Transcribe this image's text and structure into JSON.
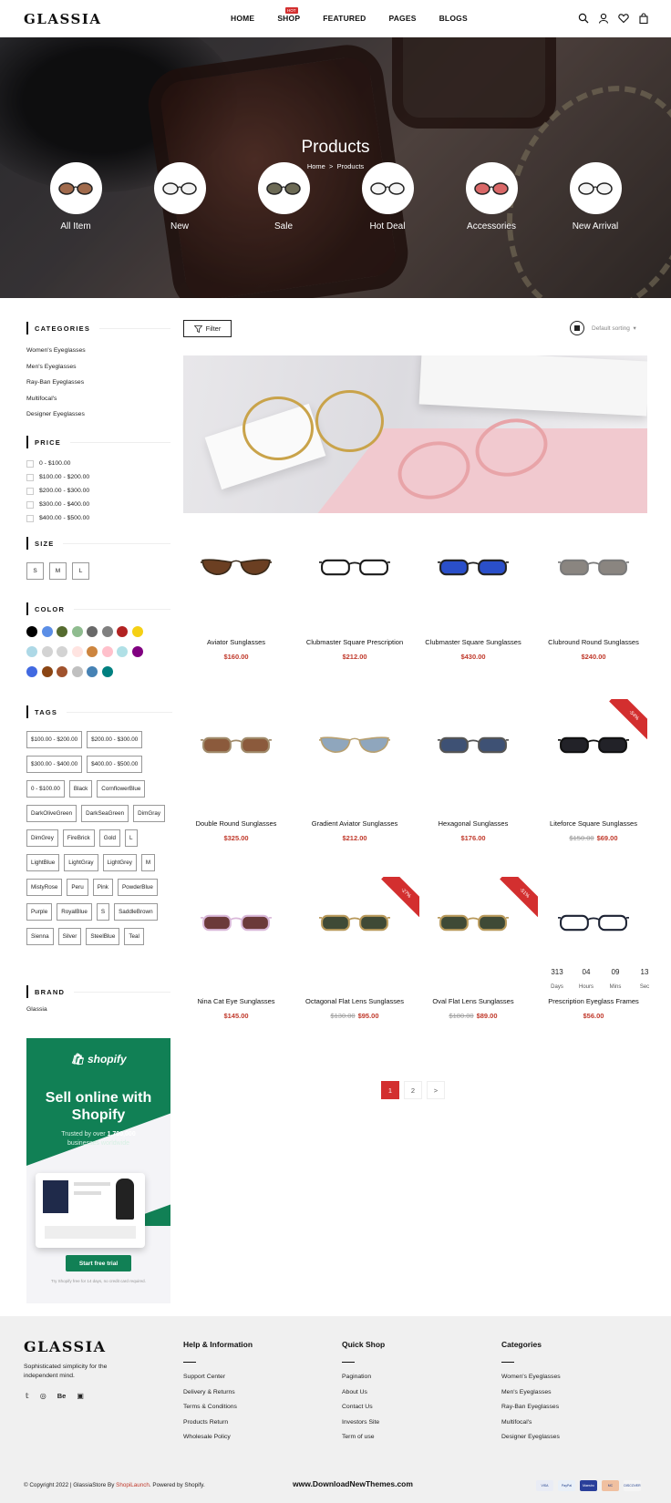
{
  "header": {
    "logo": "GLASSIA",
    "nav": [
      "HOME",
      "SHOP",
      "FEATURED",
      "PAGES",
      "BLOGS"
    ],
    "hot_badge": "HOT"
  },
  "hero": {
    "title": "Products",
    "breadcrumb_home": "Home",
    "breadcrumb_sep": ">",
    "breadcrumb_current": "Products",
    "categories": [
      "All Item",
      "New",
      "Sale",
      "Hot Deal",
      "Accessories",
      "New Arrival"
    ]
  },
  "sidebar": {
    "categories_title": "CATEGORIES",
    "categories": [
      "Women's Eyeglasses",
      "Men's Eyeglasses",
      "Ray-Ban Eyeglasses",
      "Multifocal's",
      "Designer Eyeglasses"
    ],
    "price_title": "PRICE",
    "prices": [
      "0 - $100.00",
      "$100.00 - $200.00",
      "$200.00 - $300.00",
      "$300.00 - $400.00",
      "$400.00 - $500.00"
    ],
    "size_title": "SIZE",
    "sizes": [
      "S",
      "M",
      "L"
    ],
    "color_title": "COLOR",
    "colors": [
      "#000000",
      "#5b8ee6",
      "#556b2f",
      "#8fbc8f",
      "#696969",
      "#808080",
      "#b22222",
      "#f5d015",
      "#add8e6",
      "#d3d3d3",
      "#d3d3d3",
      "#ffe4e1",
      "#cd853f",
      "#ffc0cb",
      "#b0e0e6",
      "#800080",
      "#4169e1",
      "#8b4513",
      "#a0522d",
      "#c0c0c0",
      "#4682b4",
      "#008080"
    ],
    "tags_title": "TAGS",
    "tags": [
      "$100.00 - $200.00",
      "$200.00 - $300.00",
      "$300.00 - $400.00",
      "$400.00 - $500.00",
      "0 - $100.00",
      "Black",
      "CornflowerBlue",
      "DarkOliveGreen",
      "DarkSeaGreen",
      "DimGray",
      "DimGrey",
      "FireBrick",
      "Gold",
      "L",
      "LightBlue",
      "LightGray",
      "LightGrey",
      "M",
      "MistyRose",
      "Peru",
      "Pink",
      "PowderBlue",
      "Purple",
      "RoyalBlue",
      "S",
      "SaddleBrown",
      "Sienna",
      "Silver",
      "SteelBlue",
      "Teal"
    ],
    "brand_title": "BRAND",
    "brand": "Glassia"
  },
  "toolbar": {
    "filter": "Filter",
    "sort": "Default sorting"
  },
  "products": [
    {
      "name": "Aviator Sunglasses",
      "price": "$160.00",
      "old": "",
      "badge": "",
      "lens": "#6b3f22",
      "frame": "#3a2a1a"
    },
    {
      "name": "Clubmaster Square Prescription",
      "price": "$212.00",
      "old": "",
      "badge": "",
      "lens": "#ffffff",
      "frame": "#1a1a1a"
    },
    {
      "name": "Clubmaster Square Sunglasses",
      "price": "$430.00",
      "old": "",
      "badge": "",
      "lens": "#2a4fc9",
      "frame": "#222222"
    },
    {
      "name": "Clubround Round Sunglasses",
      "price": "$240.00",
      "old": "",
      "badge": "",
      "lens": "#8a8580",
      "frame": "#7a7a7a"
    },
    {
      "name": "Double Round Sunglasses",
      "price": "$325.00",
      "old": "",
      "badge": "",
      "lens": "#8b5a3c",
      "frame": "#a08a6a"
    },
    {
      "name": "Gradient Aviator Sunglasses",
      "price": "$212.00",
      "old": "",
      "badge": "",
      "lens": "#8fa6bd",
      "frame": "#b8a070"
    },
    {
      "name": "Hexagonal Sunglasses",
      "price": "$176.00",
      "old": "",
      "badge": "",
      "lens": "#3e5174",
      "frame": "#555555"
    },
    {
      "name": "Liteforce Square Sunglasses",
      "price": "$69.00",
      "old": "$150.00",
      "badge": "-54%",
      "lens": "#222228",
      "frame": "#111111"
    },
    {
      "name": "Nina Cat Eye Sunglasses",
      "price": "$145.00",
      "old": "",
      "badge": "",
      "lens": "#6b3a3a",
      "frame": "#d9b8d9"
    },
    {
      "name": "Octagonal Flat Lens Sunglasses",
      "price": "$95.00",
      "old": "$130.00",
      "badge": "-27%",
      "lens": "#3f4a36",
      "frame": "#b8995a"
    },
    {
      "name": "Oval Flat Lens Sunglasses",
      "price": "$89.00",
      "old": "$180.00",
      "badge": "-51%",
      "lens": "#3f4a36",
      "frame": "#b8995a"
    },
    {
      "name": "Prescription Eyeglass Frames",
      "price": "$56.00",
      "old": "",
      "badge": "",
      "lens": "#ffffff",
      "frame": "#1c2233"
    }
  ],
  "countdown": [
    {
      "v": "313",
      "l": "Days"
    },
    {
      "v": "04",
      "l": "Hours"
    },
    {
      "v": "09",
      "l": "Mins"
    },
    {
      "v": "13",
      "l": "Sec"
    }
  ],
  "pagination": [
    "1",
    "2",
    ">"
  ],
  "shopify": {
    "brand": "shopify",
    "headline": "Sell online with Shopify",
    "sub": "Trusted by over",
    "sub_bold": "1,700,000",
    "sub2": "businesses worldwide",
    "cta": "Start free trial",
    "note": "Try Shopify free for 14 days, no credit card required."
  },
  "footer": {
    "logo": "GLASSIA",
    "tagline": "Sophisticated simplicity for the independent mind.",
    "social": [
      "twitter-icon",
      "dribbble-icon",
      "behance-icon",
      "instagram-icon"
    ],
    "cols": [
      {
        "title": "Help & Information",
        "links": [
          "Support Center",
          "Delivery & Returns",
          "Terms & Conditions",
          "Products Return",
          "Wholesale Policy"
        ]
      },
      {
        "title": "Quick Shop",
        "links": [
          "Pagination",
          "About Us",
          "Contact Us",
          "Investors Site",
          "Term of use"
        ]
      },
      {
        "title": "Categories",
        "links": [
          "Women's Eyeglasses",
          "Men's Eyeglasses",
          "Ray-Ban Eyeglasses",
          "Multifocal's",
          "Designer Eyeglasses"
        ]
      }
    ],
    "copyright_a": "© Copyright 2022 | GlassiaStore By",
    "copyright_brand": "ShopiLaunch",
    "copyright_b": ". Powered by Shopify.",
    "watermark": "www.DownloadNewThemes.com",
    "payments": [
      "VISA",
      "PayPal",
      "Maestro",
      "MC",
      "DISCOVER"
    ]
  }
}
